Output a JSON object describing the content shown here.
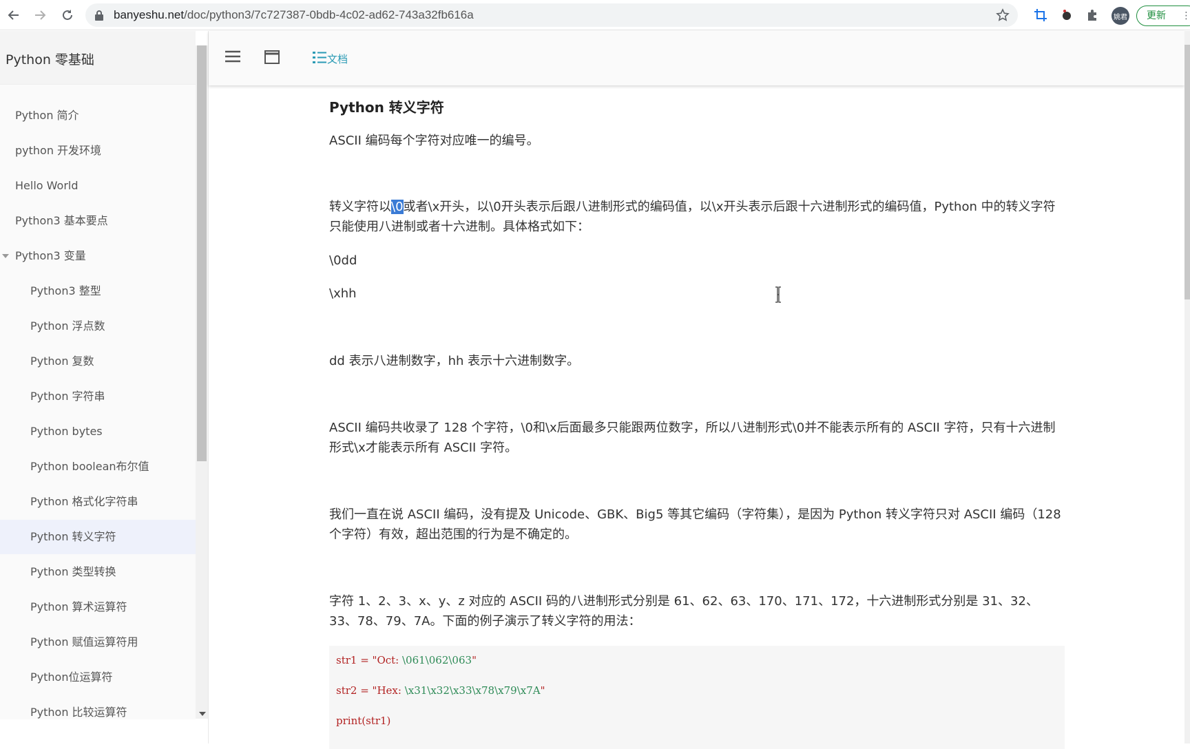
{
  "browser": {
    "url_host": "banyeshu.net",
    "url_path": "/doc/python3/7c727387-0bdb-4c02-ad62-743a32fb616a",
    "avatar_text": "姚君",
    "update_label": "更新"
  },
  "sidebar": {
    "brand": "Python 零基础",
    "items": [
      {
        "label": "Python 简介"
      },
      {
        "label": "python 开发环境"
      },
      {
        "label": "Hello World"
      },
      {
        "label": "Python3 基本要点"
      },
      {
        "label": "Python3 变量"
      },
      {
        "label": "Python3 整型"
      },
      {
        "label": "Python 浮点数"
      },
      {
        "label": "Python 复数"
      },
      {
        "label": "Python 字符串"
      },
      {
        "label": "Python bytes"
      },
      {
        "label": "Python boolean布尔值"
      },
      {
        "label": "Python 格式化字符串"
      },
      {
        "label": "Python 转义字符"
      },
      {
        "label": "Python 类型转换"
      },
      {
        "label": "Python 算术运算符"
      },
      {
        "label": "Python 赋值运算符用"
      },
      {
        "label": "Python位运算符"
      },
      {
        "label": "Python 比较运算符"
      }
    ]
  },
  "toolbar": {
    "doc_label": "文档"
  },
  "article": {
    "title": "Python 转义字符",
    "p1": "ASCII 编码每个字符对应唯一的编号。",
    "p2_a": "转义字符以",
    "p2_sel": "\\0",
    "p2_b": "或者\\x开头，以\\0开头表示后跟八进制形式的编码值，以\\x开头表示后跟十六进制形式的编码值，Python 中的转义字符只能使用八进制或者十六进制。具体格式如下：",
    "fmt1": "\\0dd",
    "fmt2": "\\xhh",
    "p3": "dd 表示八进制数字，hh 表示十六进制数字。",
    "p4": "ASCII 编码共收录了 128 个字符，\\0和\\x后面最多只能跟两位数字，所以八进制形式\\0并不能表示所有的 ASCII 字符，只有十六进制形式\\x才能表示所有 ASCII 字符。",
    "p5": "我们一直在说 ASCII 编码，没有提及 Unicode、GBK、Big5 等其它编码（字符集），是因为 Python 转义字符只对 ASCII 编码（128 个字符）有效，超出范围的行为是不确定的。",
    "p6": "字符 1、2、3、x、y、z 对应的 ASCII 码的八进制形式分别是 61、62、63、170、171、172，十六进制形式分别是 31、32、33、78、79、7A。下面的例子演示了转义字符的用法："
  },
  "code": {
    "l1_a": "str1 = \"Oct: ",
    "l1_esc": "\\061\\062\\063",
    "l1_b": "\"",
    "l2_a": "str2 = \"Hex: ",
    "l2_esc": "\\x31\\x32\\x33\\x78\\x79\\x7A",
    "l2_b": "\"",
    "l3": "print(str1)"
  }
}
